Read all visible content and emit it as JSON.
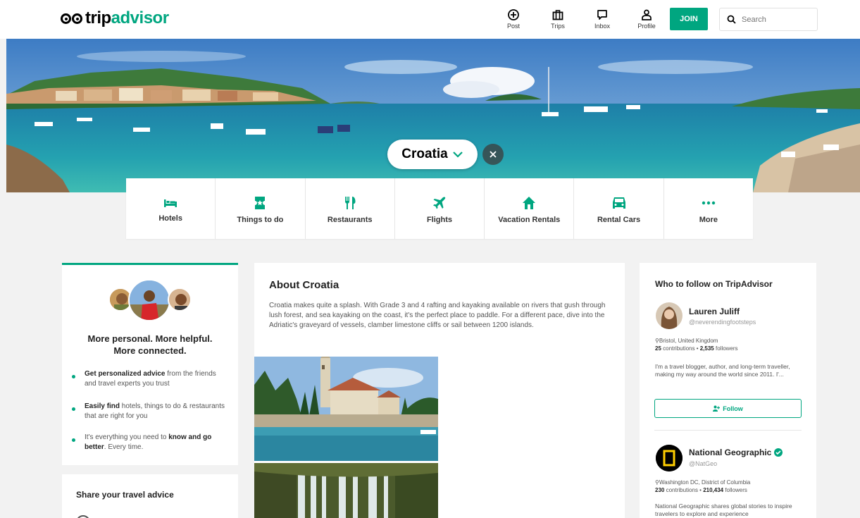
{
  "header": {
    "logo": {
      "part1": "trip",
      "part2": "advisor"
    },
    "nav": [
      {
        "label": "Post",
        "icon": "plus-circle-icon"
      },
      {
        "label": "Trips",
        "icon": "suitcase-icon"
      },
      {
        "label": "Inbox",
        "icon": "message-icon"
      },
      {
        "label": "Profile",
        "icon": "person-icon"
      }
    ],
    "join_label": "JOIN",
    "search_placeholder": "Search"
  },
  "hero": {
    "location": "Croatia"
  },
  "categories": [
    {
      "label": "Hotels",
      "icon": "bed-icon"
    },
    {
      "label": "Things to do",
      "icon": "ticket-icon"
    },
    {
      "label": "Restaurants",
      "icon": "fork-knife-icon"
    },
    {
      "label": "Flights",
      "icon": "plane-icon"
    },
    {
      "label": "Vacation Rentals",
      "icon": "house-icon"
    },
    {
      "label": "Rental Cars",
      "icon": "car-icon"
    },
    {
      "label": "More",
      "icon": "more-dots-icon"
    }
  ],
  "left": {
    "headline_line1": "More personal. More helpful.",
    "headline_line2": "More connected.",
    "bullets": [
      {
        "bold": "Get personalized advice",
        "rest": " from the friends and travel experts you trust"
      },
      {
        "bold": "Easily find",
        "rest": " hotels, things to do & restaurants that are right for you"
      },
      {
        "pre": "It's everything you need to ",
        "bold": "know and go better",
        "rest": ". Every time."
      }
    ]
  },
  "share": {
    "title": "Share your travel advice"
  },
  "about": {
    "title": "About Croatia",
    "text": "Croatia makes quite a splash. With Grade 3 and 4 rafting and kayaking available on rivers that gush through lush forest, and sea kayaking on the coast, it's the perfect place to paddle. For a different pace, dive into the Adriatic's graveyard of vessels, clamber limestone cliffs or sail between 1200 islands."
  },
  "follow": {
    "title": "Who to follow on TripAdvisor",
    "follow_label": "Follow",
    "people": [
      {
        "name": "Lauren Juliff",
        "handle": "@neverendingfootsteps",
        "location": "Bristol, United Kingdom",
        "contributions": "25",
        "contributions_label": " contributions • ",
        "followers": "2,535",
        "followers_label": " followers",
        "bio": "I'm a travel blogger, author, and long-term traveller, making my way around the world since 2011. I'..."
      },
      {
        "name": "National Geographic",
        "handle": "@NatGeo",
        "location": "Washington DC, District of Columbia",
        "contributions": "230",
        "contributions_label": " contributions • ",
        "followers": "210,434",
        "followers_label": " followers",
        "bio": "National Geographic shares global stories to inspire travelers to explore and experience"
      }
    ]
  },
  "colors": {
    "brand": "#00a680",
    "text": "#222222",
    "muted": "#555555",
    "background": "#f2f2f2"
  }
}
